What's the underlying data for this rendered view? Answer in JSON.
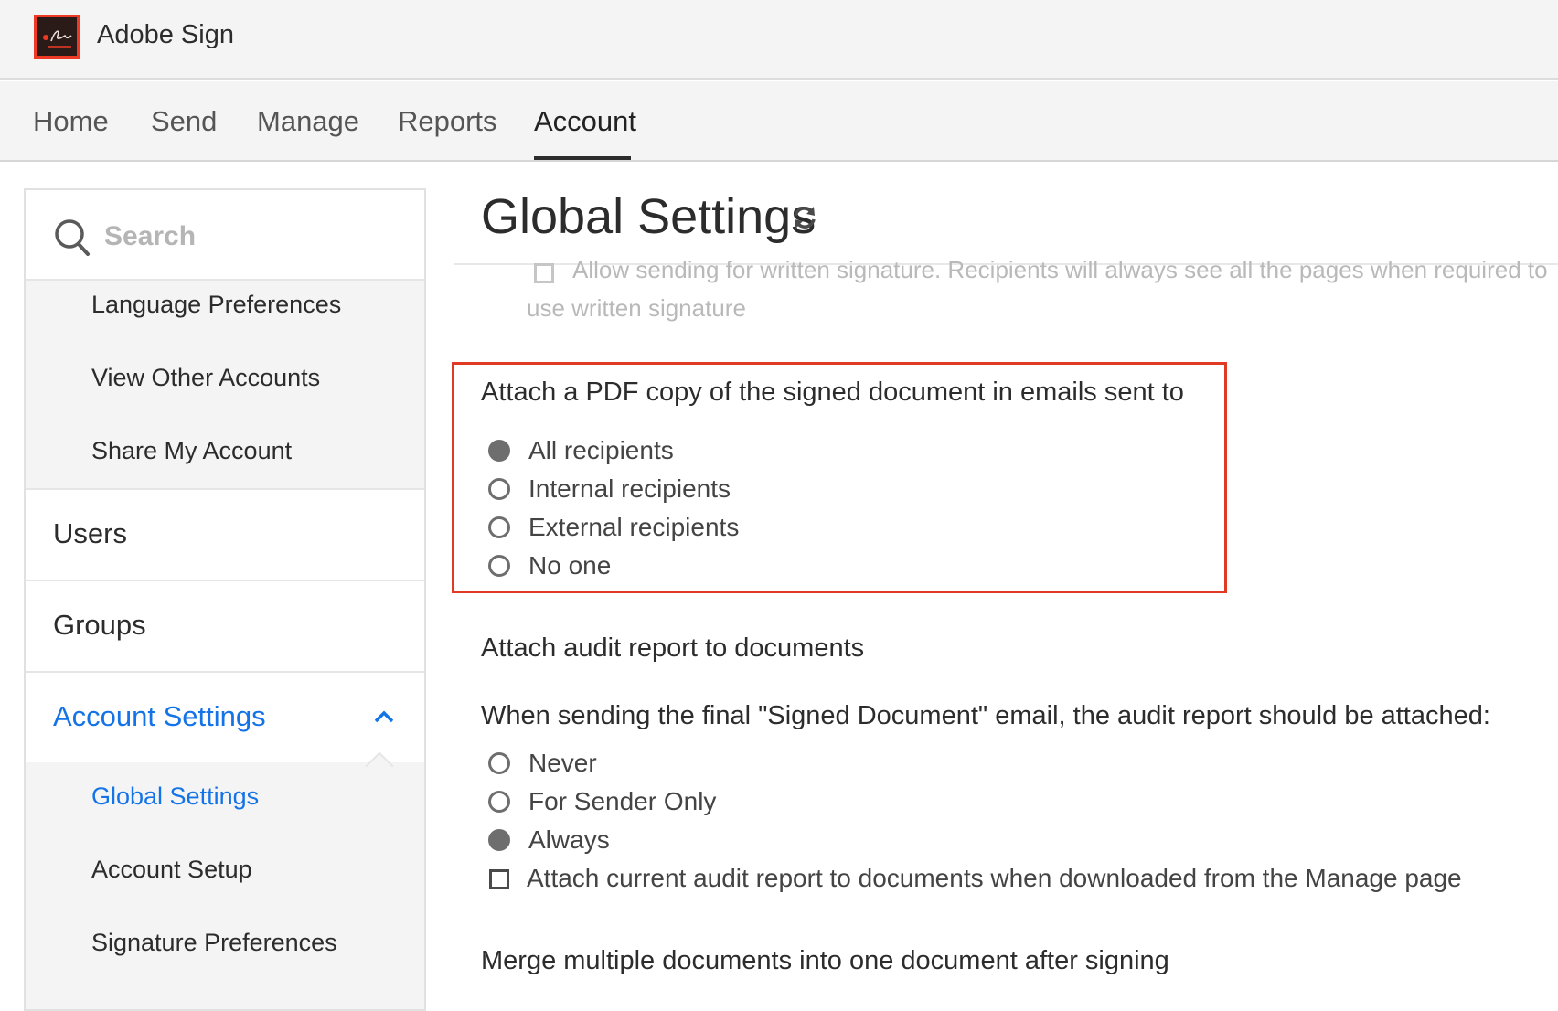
{
  "app": {
    "title": "Adobe Sign"
  },
  "nav": {
    "tabs": [
      {
        "label": "Home"
      },
      {
        "label": "Send"
      },
      {
        "label": "Manage"
      },
      {
        "label": "Reports"
      },
      {
        "label": "Account"
      }
    ],
    "active": "Account"
  },
  "sidebar": {
    "search_placeholder": "Search",
    "sub_items_top": [
      {
        "label": "Language Preferences"
      },
      {
        "label": "View Other Accounts"
      },
      {
        "label": "Share My Account"
      }
    ],
    "users": "Users",
    "groups": "Groups",
    "account_settings": "Account Settings",
    "sub_items_bottom": [
      {
        "label": "Global Settings"
      },
      {
        "label": "Account Setup"
      },
      {
        "label": "Signature Preferences"
      }
    ]
  },
  "main": {
    "title": "Global Settings",
    "faded_line1": "Allow sending for written signature. Recipients will always see all the pages when required to",
    "faded_line2": "use written signature",
    "attach_pdf": {
      "heading": "Attach a PDF copy of the signed document in emails sent to",
      "options": [
        {
          "label": "All recipients",
          "selected": true
        },
        {
          "label": "Internal recipients",
          "selected": false
        },
        {
          "label": "External recipients",
          "selected": false
        },
        {
          "label": "No one",
          "selected": false
        }
      ]
    },
    "audit": {
      "heading": "Attach audit report to documents",
      "question": "When sending the final \"Signed Document\" email, the audit report should be attached:",
      "options": [
        {
          "label": "Never",
          "selected": false
        },
        {
          "label": "For Sender Only",
          "selected": false
        },
        {
          "label": "Always",
          "selected": true
        }
      ],
      "checkbox_label": "Attach current audit report to documents when downloaded from the Manage page"
    },
    "merge_heading": "Merge multiple documents into one document after signing"
  },
  "colors": {
    "accent": "#1473e6",
    "highlight_border": "#e03a24",
    "logo_red": "#ee3a24"
  }
}
